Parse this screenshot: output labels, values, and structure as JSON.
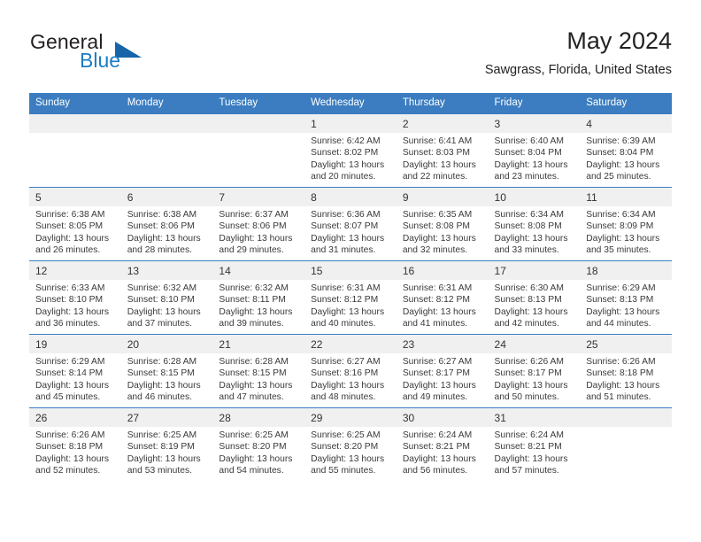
{
  "brand": {
    "name_part1": "General",
    "name_part2": "Blue",
    "triangle_color": "#1565a8",
    "blue_color": "#1a7dc4"
  },
  "header": {
    "title": "May 2024",
    "subtitle": "Sawgrass, Florida, United States"
  },
  "theme": {
    "header_row_bg": "#3b7dc0",
    "header_row_text": "#ffffff",
    "daynum_bg": "#f0f0f0",
    "row_divider": "#3b7dc0"
  },
  "weekdays": [
    "Sunday",
    "Monday",
    "Tuesday",
    "Wednesday",
    "Thursday",
    "Friday",
    "Saturday"
  ],
  "labels": {
    "sunrise_prefix": "Sunrise:",
    "sunset_prefix": "Sunset:",
    "daylight_prefix": "Daylight:"
  },
  "weeks": [
    [
      {
        "day": "",
        "empty": true
      },
      {
        "day": "",
        "empty": true
      },
      {
        "day": "",
        "empty": true
      },
      {
        "day": "1",
        "sunrise": "Sunrise: 6:42 AM",
        "sunset": "Sunset: 8:02 PM",
        "daylight_line1": "Daylight: 13 hours",
        "daylight_line2": "and 20 minutes."
      },
      {
        "day": "2",
        "sunrise": "Sunrise: 6:41 AM",
        "sunset": "Sunset: 8:03 PM",
        "daylight_line1": "Daylight: 13 hours",
        "daylight_line2": "and 22 minutes."
      },
      {
        "day": "3",
        "sunrise": "Sunrise: 6:40 AM",
        "sunset": "Sunset: 8:04 PM",
        "daylight_line1": "Daylight: 13 hours",
        "daylight_line2": "and 23 minutes."
      },
      {
        "day": "4",
        "sunrise": "Sunrise: 6:39 AM",
        "sunset": "Sunset: 8:04 PM",
        "daylight_line1": "Daylight: 13 hours",
        "daylight_line2": "and 25 minutes."
      }
    ],
    [
      {
        "day": "5",
        "sunrise": "Sunrise: 6:38 AM",
        "sunset": "Sunset: 8:05 PM",
        "daylight_line1": "Daylight: 13 hours",
        "daylight_line2": "and 26 minutes."
      },
      {
        "day": "6",
        "sunrise": "Sunrise: 6:38 AM",
        "sunset": "Sunset: 8:06 PM",
        "daylight_line1": "Daylight: 13 hours",
        "daylight_line2": "and 28 minutes."
      },
      {
        "day": "7",
        "sunrise": "Sunrise: 6:37 AM",
        "sunset": "Sunset: 8:06 PM",
        "daylight_line1": "Daylight: 13 hours",
        "daylight_line2": "and 29 minutes."
      },
      {
        "day": "8",
        "sunrise": "Sunrise: 6:36 AM",
        "sunset": "Sunset: 8:07 PM",
        "daylight_line1": "Daylight: 13 hours",
        "daylight_line2": "and 31 minutes."
      },
      {
        "day": "9",
        "sunrise": "Sunrise: 6:35 AM",
        "sunset": "Sunset: 8:08 PM",
        "daylight_line1": "Daylight: 13 hours",
        "daylight_line2": "and 32 minutes."
      },
      {
        "day": "10",
        "sunrise": "Sunrise: 6:34 AM",
        "sunset": "Sunset: 8:08 PM",
        "daylight_line1": "Daylight: 13 hours",
        "daylight_line2": "and 33 minutes."
      },
      {
        "day": "11",
        "sunrise": "Sunrise: 6:34 AM",
        "sunset": "Sunset: 8:09 PM",
        "daylight_line1": "Daylight: 13 hours",
        "daylight_line2": "and 35 minutes."
      }
    ],
    [
      {
        "day": "12",
        "sunrise": "Sunrise: 6:33 AM",
        "sunset": "Sunset: 8:10 PM",
        "daylight_line1": "Daylight: 13 hours",
        "daylight_line2": "and 36 minutes."
      },
      {
        "day": "13",
        "sunrise": "Sunrise: 6:32 AM",
        "sunset": "Sunset: 8:10 PM",
        "daylight_line1": "Daylight: 13 hours",
        "daylight_line2": "and 37 minutes."
      },
      {
        "day": "14",
        "sunrise": "Sunrise: 6:32 AM",
        "sunset": "Sunset: 8:11 PM",
        "daylight_line1": "Daylight: 13 hours",
        "daylight_line2": "and 39 minutes."
      },
      {
        "day": "15",
        "sunrise": "Sunrise: 6:31 AM",
        "sunset": "Sunset: 8:12 PM",
        "daylight_line1": "Daylight: 13 hours",
        "daylight_line2": "and 40 minutes."
      },
      {
        "day": "16",
        "sunrise": "Sunrise: 6:31 AM",
        "sunset": "Sunset: 8:12 PM",
        "daylight_line1": "Daylight: 13 hours",
        "daylight_line2": "and 41 minutes."
      },
      {
        "day": "17",
        "sunrise": "Sunrise: 6:30 AM",
        "sunset": "Sunset: 8:13 PM",
        "daylight_line1": "Daylight: 13 hours",
        "daylight_line2": "and 42 minutes."
      },
      {
        "day": "18",
        "sunrise": "Sunrise: 6:29 AM",
        "sunset": "Sunset: 8:13 PM",
        "daylight_line1": "Daylight: 13 hours",
        "daylight_line2": "and 44 minutes."
      }
    ],
    [
      {
        "day": "19",
        "sunrise": "Sunrise: 6:29 AM",
        "sunset": "Sunset: 8:14 PM",
        "daylight_line1": "Daylight: 13 hours",
        "daylight_line2": "and 45 minutes."
      },
      {
        "day": "20",
        "sunrise": "Sunrise: 6:28 AM",
        "sunset": "Sunset: 8:15 PM",
        "daylight_line1": "Daylight: 13 hours",
        "daylight_line2": "and 46 minutes."
      },
      {
        "day": "21",
        "sunrise": "Sunrise: 6:28 AM",
        "sunset": "Sunset: 8:15 PM",
        "daylight_line1": "Daylight: 13 hours",
        "daylight_line2": "and 47 minutes."
      },
      {
        "day": "22",
        "sunrise": "Sunrise: 6:27 AM",
        "sunset": "Sunset: 8:16 PM",
        "daylight_line1": "Daylight: 13 hours",
        "daylight_line2": "and 48 minutes."
      },
      {
        "day": "23",
        "sunrise": "Sunrise: 6:27 AM",
        "sunset": "Sunset: 8:17 PM",
        "daylight_line1": "Daylight: 13 hours",
        "daylight_line2": "and 49 minutes."
      },
      {
        "day": "24",
        "sunrise": "Sunrise: 6:26 AM",
        "sunset": "Sunset: 8:17 PM",
        "daylight_line1": "Daylight: 13 hours",
        "daylight_line2": "and 50 minutes."
      },
      {
        "day": "25",
        "sunrise": "Sunrise: 6:26 AM",
        "sunset": "Sunset: 8:18 PM",
        "daylight_line1": "Daylight: 13 hours",
        "daylight_line2": "and 51 minutes."
      }
    ],
    [
      {
        "day": "26",
        "sunrise": "Sunrise: 6:26 AM",
        "sunset": "Sunset: 8:18 PM",
        "daylight_line1": "Daylight: 13 hours",
        "daylight_line2": "and 52 minutes."
      },
      {
        "day": "27",
        "sunrise": "Sunrise: 6:25 AM",
        "sunset": "Sunset: 8:19 PM",
        "daylight_line1": "Daylight: 13 hours",
        "daylight_line2": "and 53 minutes."
      },
      {
        "day": "28",
        "sunrise": "Sunrise: 6:25 AM",
        "sunset": "Sunset: 8:20 PM",
        "daylight_line1": "Daylight: 13 hours",
        "daylight_line2": "and 54 minutes."
      },
      {
        "day": "29",
        "sunrise": "Sunrise: 6:25 AM",
        "sunset": "Sunset: 8:20 PM",
        "daylight_line1": "Daylight: 13 hours",
        "daylight_line2": "and 55 minutes."
      },
      {
        "day": "30",
        "sunrise": "Sunrise: 6:24 AM",
        "sunset": "Sunset: 8:21 PM",
        "daylight_line1": "Daylight: 13 hours",
        "daylight_line2": "and 56 minutes."
      },
      {
        "day": "31",
        "sunrise": "Sunrise: 6:24 AM",
        "sunset": "Sunset: 8:21 PM",
        "daylight_line1": "Daylight: 13 hours",
        "daylight_line2": "and 57 minutes."
      },
      {
        "day": "",
        "empty": true
      }
    ]
  ]
}
